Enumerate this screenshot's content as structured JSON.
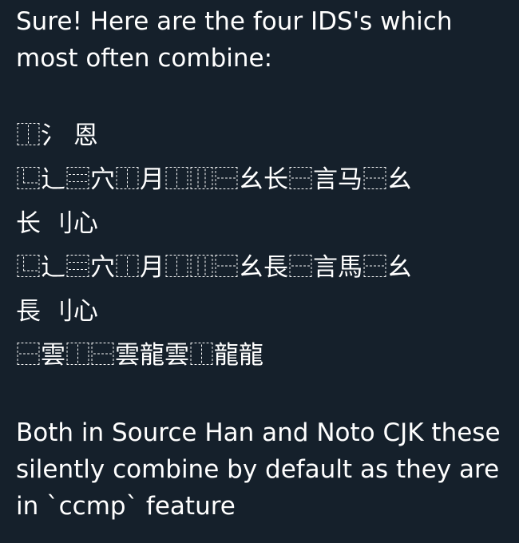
{
  "post": {
    "intro": "Sure! Here are the four IDS's which most often combine:",
    "ids_lines": [
      "⿰氵 恩",
      "⿺辶⿳穴⿰月⿰⿲⿱幺长⿱言马⿱幺",
      "长 刂心",
      "⿺辶⿳穴⿰月⿰⿲⿱幺長⿱言馬⿱幺",
      "長 刂心",
      "⿱雲⿰⿱雲龍雲⿰龍龍"
    ],
    "outro": "Both in Source Han and Noto CJK these silently combine by default as they are in `ccmp` feature"
  }
}
